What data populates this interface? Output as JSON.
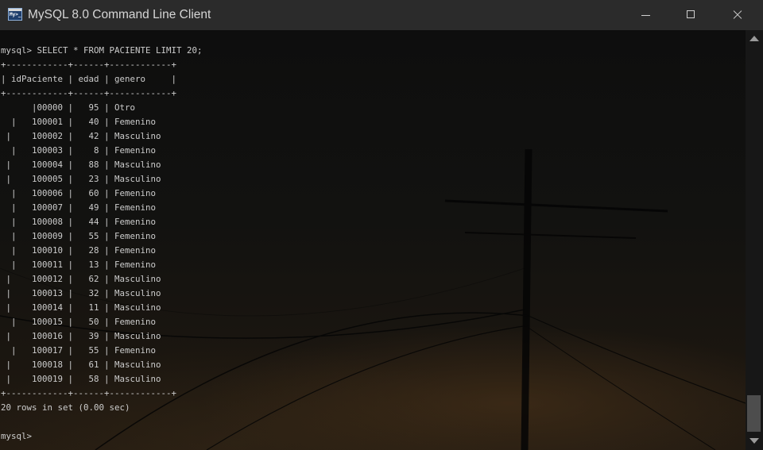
{
  "window": {
    "title": "MySQL 8.0 Command Line Client",
    "icon": "mysql-console-icon",
    "icon_text": "My>_"
  },
  "terminal": {
    "command": "mysql> SELECT * FROM PACIENTE LIMIT 20;",
    "table": {
      "border_line": "+------------+------+------------+",
      "header_line": "| idPaciente | edad | genero     |",
      "rows": [
        "      |00000 |   95 | Otro",
        "  |   100001 |   40 | Femenino",
        " |    100002 |   42 | Masculino",
        "  |   100003 |    8 | Femenino",
        " |    100004 |   88 | Masculino",
        " |    100005 |   23 | Masculino",
        "  |   100006 |   60 | Femenino",
        "  |   100007 |   49 | Femenino",
        "  |   100008 |   44 | Femenino",
        "  |   100009 |   55 | Femenino",
        "  |   100010 |   28 | Femenino",
        "  |   100011 |   13 | Femenino",
        " |    100012 |   62 | Masculino",
        " |    100013 |   32 | Masculino",
        " |    100014 |   11 | Masculino",
        "  |   100015 |   50 | Femenino",
        " |    100016 |   39 | Masculino",
        "  |   100017 |   55 | Femenino",
        " |    100018 |   61 | Masculino",
        " |    100019 |   58 | Masculino"
      ]
    },
    "result": "20 rows in set (0.00 sec)",
    "prompt": "mysql>"
  },
  "colors": {
    "titlebar": "#2b2b2b",
    "title_text": "#d6d6d6",
    "console_text": "#cccccc",
    "console_bg": "#0c0c0c"
  }
}
